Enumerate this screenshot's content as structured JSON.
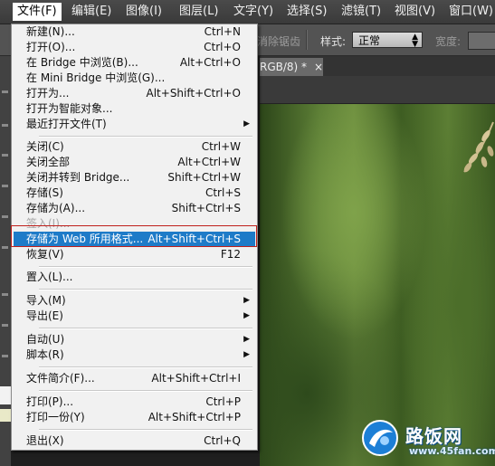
{
  "menubar": {
    "items": [
      {
        "label": "文件(F)"
      },
      {
        "label": "编辑(E)"
      },
      {
        "label": "图像(I)"
      },
      {
        "label": "图层(L)"
      },
      {
        "label": "文字(Y)"
      },
      {
        "label": "选择(S)"
      },
      {
        "label": "滤镜(T)"
      },
      {
        "label": "视图(V)"
      },
      {
        "label": "窗口(W)"
      }
    ]
  },
  "options_bar": {
    "antialias_label": "消除锯齿",
    "style_label": "样式:",
    "style_value": "正常",
    "width_label": "宽度:"
  },
  "document": {
    "tab_label": "RGB/8) *",
    "close_glyph": "×"
  },
  "file_menu": {
    "items": [
      {
        "label": "新建(N)...",
        "shortcut": "Ctrl+N"
      },
      {
        "label": "打开(O)...",
        "shortcut": "Ctrl+O"
      },
      {
        "label": "在 Bridge 中浏览(B)...",
        "shortcut": "Alt+Ctrl+O"
      },
      {
        "label": "在 Mini Bridge 中浏览(G)...",
        "shortcut": ""
      },
      {
        "label": "打开为...",
        "shortcut": "Alt+Shift+Ctrl+O"
      },
      {
        "label": "打开为智能对象...",
        "shortcut": ""
      },
      {
        "label": "最近打开文件(T)",
        "submenu": true
      },
      {
        "label": "关闭(C)",
        "shortcut": "Ctrl+W"
      },
      {
        "label": "关闭全部",
        "shortcut": "Alt+Ctrl+W"
      },
      {
        "label": "关闭并转到 Bridge...",
        "shortcut": "Shift+Ctrl+W"
      },
      {
        "label": "存储(S)",
        "shortcut": "Ctrl+S"
      },
      {
        "label": "存储为(A)...",
        "shortcut": "Shift+Ctrl+S"
      },
      {
        "label": "签入(I)...",
        "shortcut": "",
        "disabled": true
      },
      {
        "label": "存储为 Web 所用格式...",
        "shortcut": "Alt+Shift+Ctrl+S",
        "highlighted": true
      },
      {
        "label": "恢复(V)",
        "shortcut": "F12"
      },
      {
        "label": "置入(L)...",
        "shortcut": ""
      },
      {
        "label": "导入(M)",
        "submenu": true
      },
      {
        "label": "导出(E)",
        "submenu": true
      },
      {
        "label": "自动(U)",
        "submenu": true
      },
      {
        "label": "脚本(R)",
        "submenu": true
      },
      {
        "label": "文件简介(F)...",
        "shortcut": "Alt+Shift+Ctrl+I"
      },
      {
        "label": "打印(P)...",
        "shortcut": "Ctrl+P"
      },
      {
        "label": "打印一份(Y)",
        "shortcut": "Alt+Shift+Ctrl+P"
      },
      {
        "label": "退出(X)",
        "shortcut": "Ctrl+Q"
      }
    ],
    "submenu_arrow": "▶"
  },
  "watermark": {
    "name": "路饭网",
    "domain": "www.45fan.com"
  },
  "colors": {
    "menu_highlight": "#1e7bc8",
    "annotation_box": "#c0201c",
    "menu_bg": "#f1f1f1"
  }
}
